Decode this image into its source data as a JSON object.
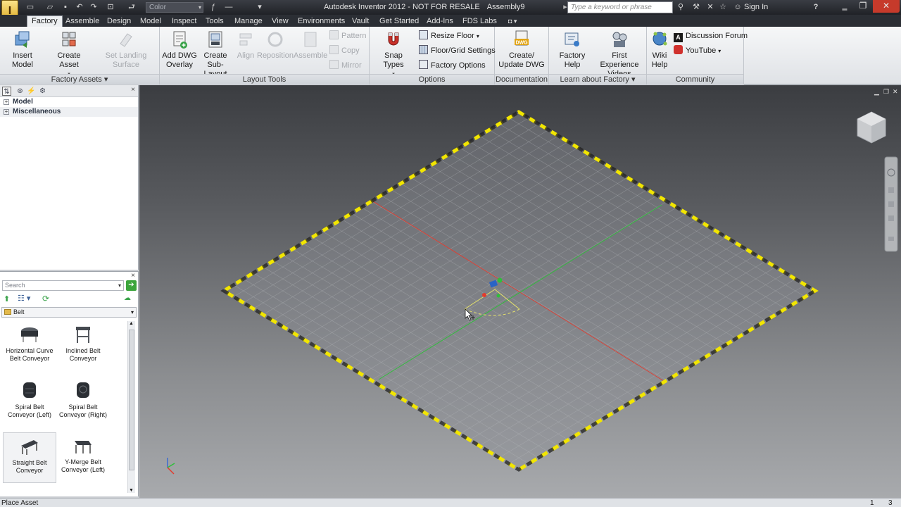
{
  "titlebar": {
    "app_title": "Autodesk Inventor 2012 - NOT FOR RESALE",
    "document": "Assembly9",
    "color_selector": "Color",
    "search_placeholder": "Type a keyword or phrase",
    "sign_in": "Sign In"
  },
  "tabs": [
    "Factory",
    "Assemble",
    "Design",
    "Model",
    "Inspect",
    "Tools",
    "Manage",
    "View",
    "Environments",
    "Vault",
    "Get Started",
    "Add-Ins",
    "FDS Labs"
  ],
  "ribbon": {
    "factory_assets": {
      "title": "Factory Assets",
      "insert_model": "Insert Model",
      "create_asset": "Create Asset",
      "set_landing_surface": "Set Landing Surface"
    },
    "layout_tools": {
      "title": "Layout Tools",
      "add_dwg_overlay_1": "Add DWG",
      "add_dwg_overlay_2": "Overlay",
      "create_sub_layout_1": "Create",
      "create_sub_layout_2": "Sub-Layout",
      "align": "Align",
      "reposition": "Reposition",
      "assemble": "Assemble",
      "pattern": "Pattern",
      "copy": "Copy",
      "mirror": "Mirror"
    },
    "options": {
      "title": "Options",
      "snap_types": "Snap Types",
      "resize_floor": "Resize Floor",
      "floor_grid_settings": "Floor/Grid Settings",
      "factory_options": "Factory Options"
    },
    "documentation": {
      "title": "Documentation",
      "create_update_dwg_1": "Create/",
      "create_update_dwg_2": "Update DWG",
      "dwg_icon_label": "DWG"
    },
    "learn": {
      "title": "Learn about Factory",
      "factory_help": "Factory Help",
      "first_experience_1": "First Experience",
      "first_experience_2": "Videos"
    },
    "community": {
      "title": "Community",
      "wiki_help_1": "Wiki",
      "wiki_help_2": "Help",
      "discussion_forum": "Discussion Forum",
      "discussion_icon_label": "A",
      "youtube": "YouTube"
    }
  },
  "browser": {
    "items": [
      "Model",
      "Miscellaneous"
    ]
  },
  "asset_browser": {
    "search_placeholder": "Search",
    "category": "Belt",
    "assets": [
      {
        "line1": "Horizontal Curve",
        "line2": "Belt Conveyor"
      },
      {
        "line1": "Inclined Belt",
        "line2": "Conveyor"
      },
      {
        "line1": "Spiral Belt",
        "line2": "Conveyor (Left)"
      },
      {
        "line1": "Spiral Belt",
        "line2": "Conveyor (Right)"
      },
      {
        "line1": "Straight Belt",
        "line2": "Conveyor"
      },
      {
        "line1": "Y-Merge Belt",
        "line2": "Conveyor (Left)"
      }
    ]
  },
  "statusbar": {
    "prompt": "Place Asset",
    "count_a": "1",
    "count_b": "3"
  },
  "colors": {
    "floor_border": "#f2e600",
    "axis_x": "#e23b2e",
    "axis_y": "#2fbf3a"
  }
}
